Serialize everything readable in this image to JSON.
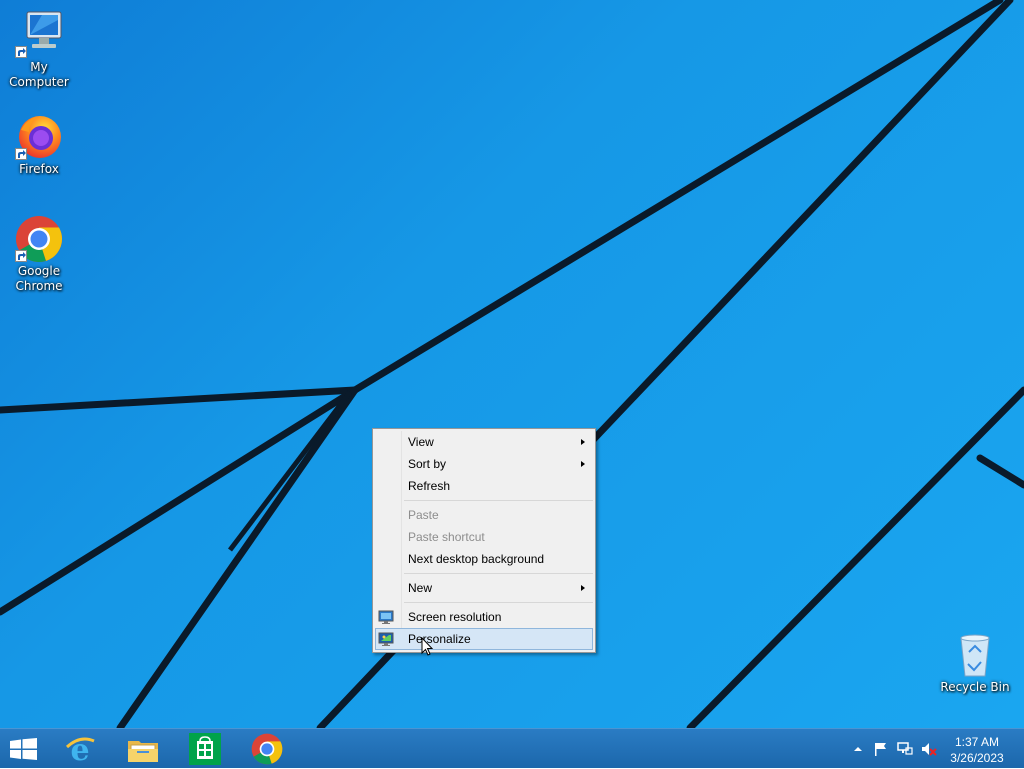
{
  "desktop": {
    "icons": [
      {
        "label": "My Computer",
        "icon": "computer-icon"
      },
      {
        "label": "Firefox",
        "icon": "firefox-icon"
      },
      {
        "label_line1": "Google",
        "label_line2": "Chrome",
        "icon": "chrome-icon"
      },
      {
        "label": "Recycle Bin",
        "icon": "recycle-bin-icon"
      }
    ]
  },
  "context_menu": {
    "items": [
      {
        "label": "View",
        "has_submenu": true,
        "enabled": true
      },
      {
        "label": "Sort by",
        "has_submenu": true,
        "enabled": true
      },
      {
        "label": "Refresh",
        "enabled": true
      },
      {
        "label": "Paste",
        "enabled": false
      },
      {
        "label": "Paste shortcut",
        "enabled": false
      },
      {
        "label": "Next desktop background",
        "enabled": true
      },
      {
        "label": "New",
        "has_submenu": true,
        "enabled": true
      },
      {
        "label": "Screen resolution",
        "icon": "display-icon",
        "enabled": true
      },
      {
        "label": "Personalize",
        "icon": "personalize-icon",
        "enabled": true,
        "highlighted": true
      }
    ]
  },
  "taskbar": {
    "pinned": [
      "start-icon",
      "internet-explorer-icon",
      "file-explorer-icon",
      "store-icon",
      "chrome-icon"
    ],
    "tray": [
      "show-hidden-icons-icon",
      "action-center-flag-icon",
      "network-icon",
      "volume-muted-icon"
    ],
    "clock": {
      "time": "1:37 AM",
      "date": "3/26/2023"
    }
  },
  "colors": {
    "desktop_blue": "#1698e6",
    "taskbar_blue": "#1f6fb5",
    "menu_highlight": "#d5e6f6"
  }
}
